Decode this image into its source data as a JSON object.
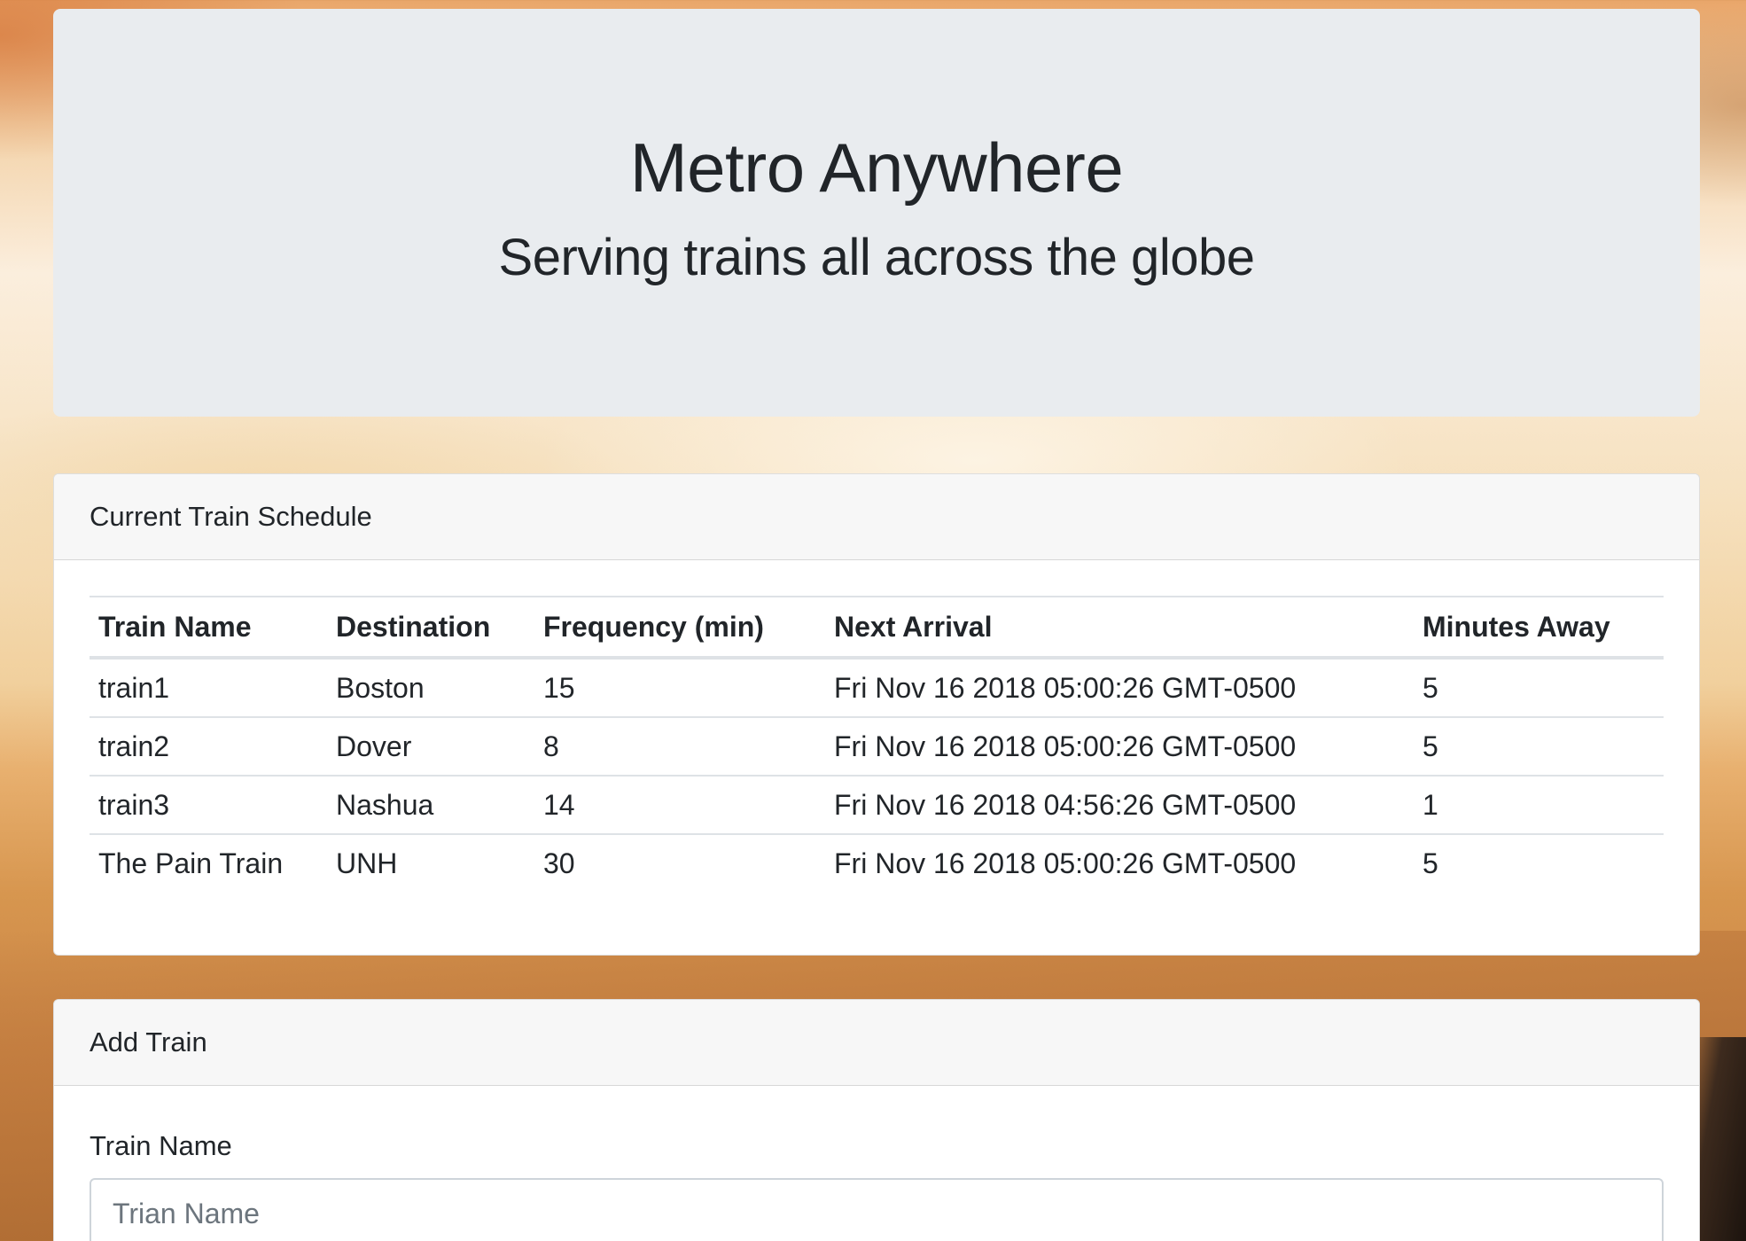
{
  "header": {
    "title": "Metro Anywhere",
    "subtitle": "Serving trains all across the globe"
  },
  "schedule": {
    "title": "Current Train Schedule",
    "columns": [
      "Train Name",
      "Destination",
      "Frequency (min)",
      "Next Arrival",
      "Minutes Away"
    ],
    "rows": [
      [
        "train1",
        "Boston",
        "15",
        "Fri Nov 16 2018 05:00:26 GMT-0500",
        "5"
      ],
      [
        "train2",
        "Dover",
        "8",
        "Fri Nov 16 2018 05:00:26 GMT-0500",
        "5"
      ],
      [
        "train3",
        "Nashua",
        "14",
        "Fri Nov 16 2018 04:56:26 GMT-0500",
        "1"
      ],
      [
        "The Pain Train",
        "UNH",
        "30",
        "Fri Nov 16 2018 05:00:26 GMT-0500",
        "5"
      ]
    ]
  },
  "add_train": {
    "title": "Add Train",
    "name_label": "Train Name",
    "name_placeholder": "Trian Name",
    "name_value": ""
  },
  "colors": {
    "jumbotron_bg": "#e9ecef",
    "card_header_bg": "#f7f7f7",
    "text": "#212529"
  }
}
